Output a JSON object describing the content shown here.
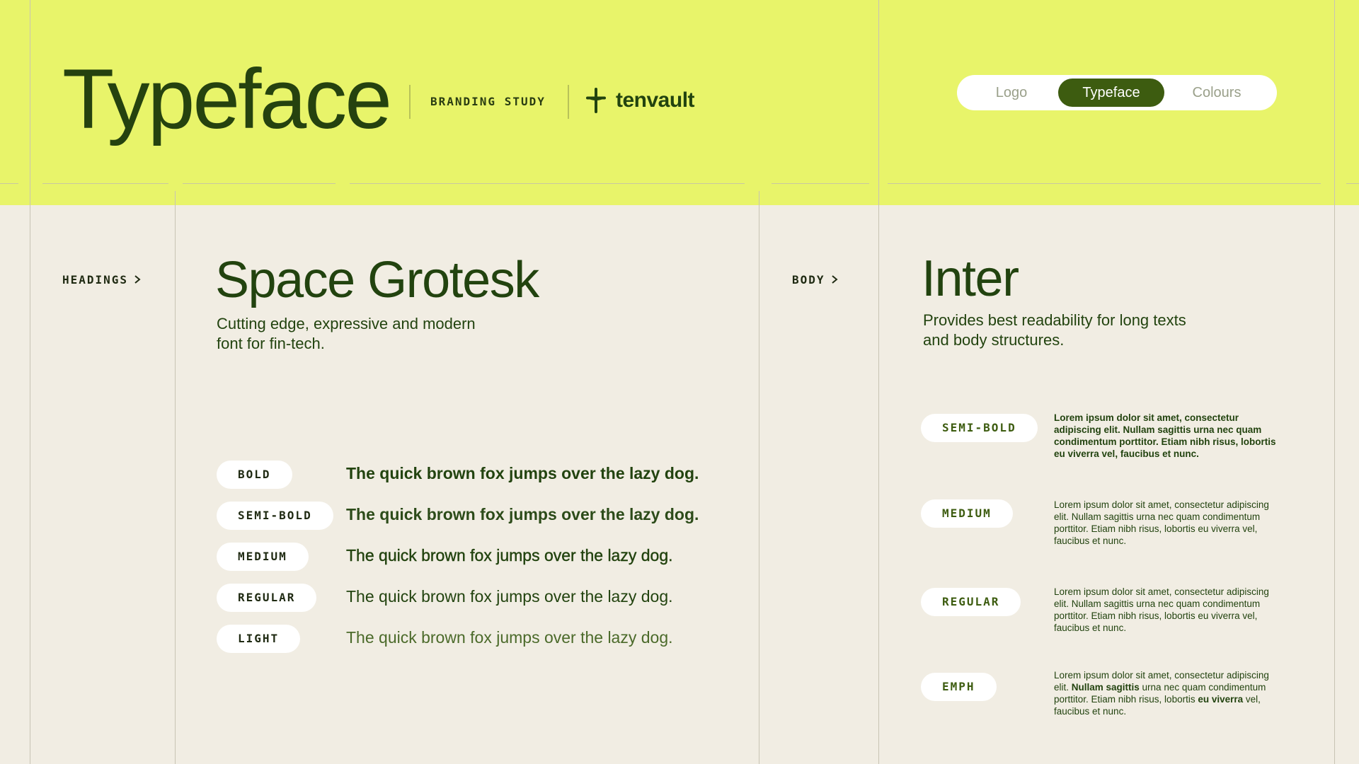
{
  "header": {
    "title": "Typeface",
    "kicker": "BRANDING STUDY",
    "brand_name": "tenvault",
    "nav": [
      {
        "label": "Logo",
        "active": false
      },
      {
        "label": "Typeface",
        "active": true
      },
      {
        "label": "Colours",
        "active": false
      }
    ]
  },
  "headings": {
    "tag": "HEADINGS",
    "font_name": "Space Grotesk",
    "description": "Cutting edge, expressive and modern font for fin-tech.",
    "weights": [
      {
        "label": "BOLD",
        "sample": "The quick brown fox jumps over the lazy dog."
      },
      {
        "label": "SEMI-BOLD",
        "sample": "The quick brown fox jumps over the lazy dog."
      },
      {
        "label": "MEDIUM",
        "sample": "The quick brown fox jumps over the lazy dog."
      },
      {
        "label": "REGULAR",
        "sample": "The quick brown fox jumps over the lazy dog."
      },
      {
        "label": "LIGHT",
        "sample": "The quick brown fox jumps over the lazy dog."
      }
    ]
  },
  "body": {
    "tag": "BODY",
    "font_name": "Inter",
    "description": "Provides best readability for long texts and body structures.",
    "weights": [
      {
        "label": "SEMI-BOLD",
        "text": "Lorem ipsum dolor sit amet, consectetur adipiscing elit. Nullam sagittis urna nec quam condimentum porttitor. Etiam nibh risus, lobortis eu viverra vel, faucibus et nunc."
      },
      {
        "label": "MEDIUM",
        "text": "Lorem ipsum dolor sit amet, consectetur adipiscing elit. Nullam sagittis urna nec quam condimentum porttitor. Etiam nibh risus, lobortis eu viverra vel, faucibus et nunc."
      },
      {
        "label": "REGULAR",
        "text": "Lorem ipsum dolor sit amet, consectetur adipiscing elit. Nullam sagittis urna nec quam condimentum porttitor. Etiam nibh risus, lobortis eu viverra vel, faucibus et nunc."
      },
      {
        "label": "EMPH",
        "text_a": "Lorem ipsum dolor sit amet, consectetur adipiscing elit. ",
        "text_b": "Nullam sagittis",
        "text_c": " urna nec quam condimentum porttitor. Etiam nibh risus, lobortis ",
        "text_d": "eu viverra",
        "text_e": " vel, faucibus et nunc."
      }
    ]
  },
  "colors": {
    "header_bg": "#e8f46a",
    "page_bg": "#f1ede3",
    "primary_green": "#22430f",
    "nav_active": "#3d5c10"
  }
}
